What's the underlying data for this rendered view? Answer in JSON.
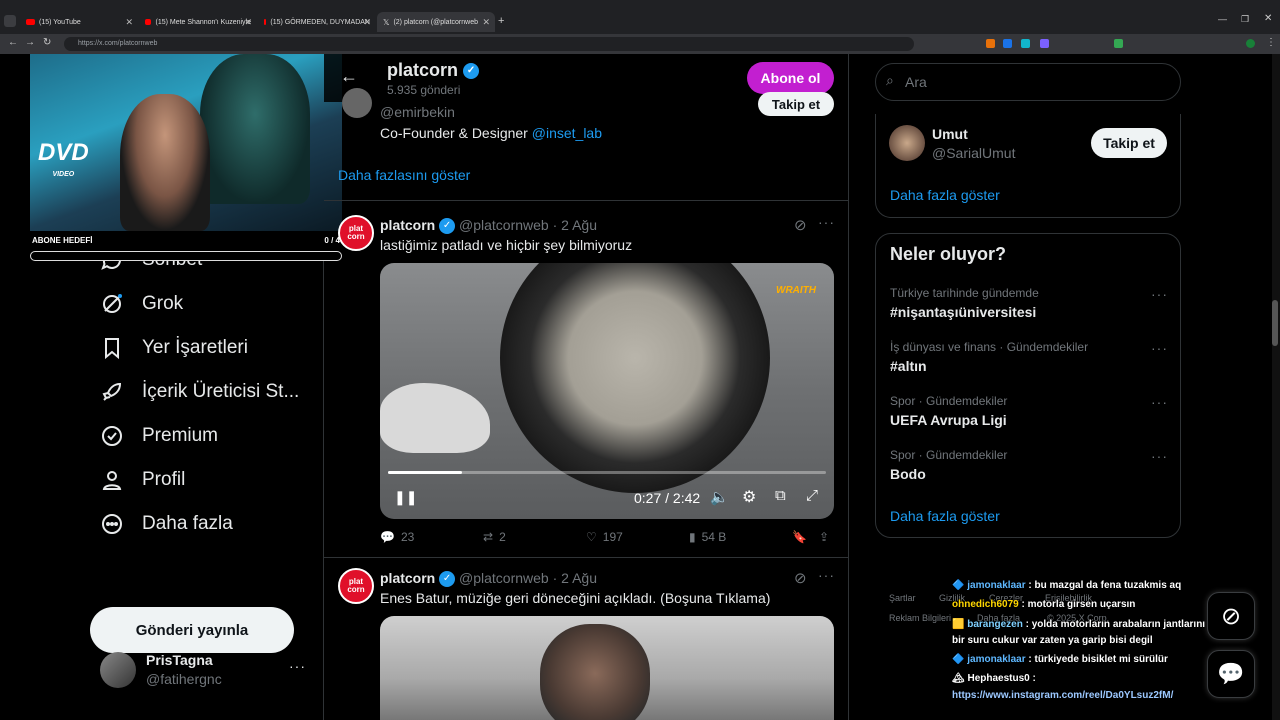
{
  "browser": {
    "tabs": [
      {
        "label": "(15) YouTube"
      },
      {
        "label": "(15) Mete Shannon'ı Kuzeniyle"
      },
      {
        "label": "(15) GÖRMEDEN, DUYMADAN"
      },
      {
        "label": "(2) platcorn (@platcornweb"
      }
    ],
    "url": "https://x.com/platcornweb"
  },
  "stream_overlay": {
    "goal_label": "ABONE HEDEFİ",
    "goal_count": "0 / 4",
    "goal_progress": 0,
    "dvd_text": "DVD",
    "dvd_sub": "VIDEO"
  },
  "sidebar": {
    "items": [
      {
        "label": "Sohbet",
        "icon": "chat-icon"
      },
      {
        "label": "Grok",
        "icon": "grok-icon"
      },
      {
        "label": "Yer İşaretleri",
        "icon": "bookmark-icon"
      },
      {
        "label": "İçerik Üreticisi St...",
        "icon": "rocket-icon"
      },
      {
        "label": "Premium",
        "icon": "premium-icon"
      },
      {
        "label": "Profil",
        "icon": "profile-icon"
      },
      {
        "label": "Daha fazla",
        "icon": "more-circle-icon"
      }
    ],
    "post_button": "Gönderi yayınla",
    "account": {
      "name": "PrisTagna",
      "handle": "@fatihergnc"
    }
  },
  "profile_header": {
    "name": "platcorn",
    "post_count": "5.935 gönderi",
    "subscribe_label": "Abone ol"
  },
  "prev_tweet": {
    "handle": "@emirbekin",
    "follow_label": "Takip et",
    "bio": "Co-Founder & Designer ",
    "bio_link": "@inset_lab",
    "show_more": "Daha fazlasını göster"
  },
  "tweets": [
    {
      "name": "platcorn",
      "handle": "@platcornweb",
      "date": "· 2 Ağu",
      "text": "lastiğimiz patladı ve hiçbir şey bilmiyoruz",
      "video": {
        "time": "0:27 / 2:42",
        "watermark": "WRAITH",
        "progress": 0.17
      },
      "replies": "23",
      "reposts": "2",
      "likes": "197",
      "views": "54 B"
    },
    {
      "name": "platcorn",
      "handle": "@platcornweb",
      "date": "· 2 Ağu",
      "text": "Enes Batur, müziğe geri döneceğini açıkladı. (Boşuna Tıklama)"
    }
  ],
  "logo_text": "plat corn",
  "right": {
    "search_placeholder": "Ara",
    "follow_suggestion": {
      "name": "Umut",
      "handle": "@SarialUmut",
      "button": "Takip et"
    },
    "show_more_1": "Daha fazla göster",
    "trends_title": "Neler oluyor?",
    "trends": [
      {
        "context": "Türkiye tarihinde gündemde",
        "name": "#nişantaşıüniversitesi"
      },
      {
        "context": "İş dünyası ve finans · Gündemdekiler",
        "name": "#altın"
      },
      {
        "context": "Spor · Gündemdekiler",
        "name": "UEFA Avrupa Ligi"
      },
      {
        "context": "Spor · Gündemdekiler",
        "name": "Bodo"
      }
    ],
    "show_more_2": "Daha fazla göster",
    "footer": [
      "Şartlar",
      "Gizlilik",
      "Çerezler",
      "Erişilebilirlik",
      "Reklam Bilgileri",
      "Daha fazla",
      "© 2025 X Corp."
    ]
  },
  "chat": [
    {
      "user": "jamonaklaar",
      "msg": " : bu mazgal da fena tuzakmis aq",
      "color": "#5fb8ff"
    },
    {
      "user": "ohnedich6079",
      "msg": " : motorla girsen uçarsın",
      "color": "#ffd700"
    },
    {
      "user": "barangezen",
      "msg": " : yolda motorların arabaların jantlarını yamultan",
      "color": "#7fd0ff"
    },
    {
      "user": "",
      "msg": "bir suru cukur var zaten ya garip bisi degil",
      "color": "#ffffff"
    },
    {
      "user": "jamonaklaar",
      "msg": " : türkiyede bisiklet mi sürülür",
      "color": "#5fb8ff"
    },
    {
      "user": "Hephaestus0",
      "msg": " :",
      "color": "#ffffff"
    },
    {
      "user": "",
      "msg": "https://www.instagram.com/reel/Da0YLsuz2fM/",
      "color": "#9cc8ff"
    }
  ]
}
